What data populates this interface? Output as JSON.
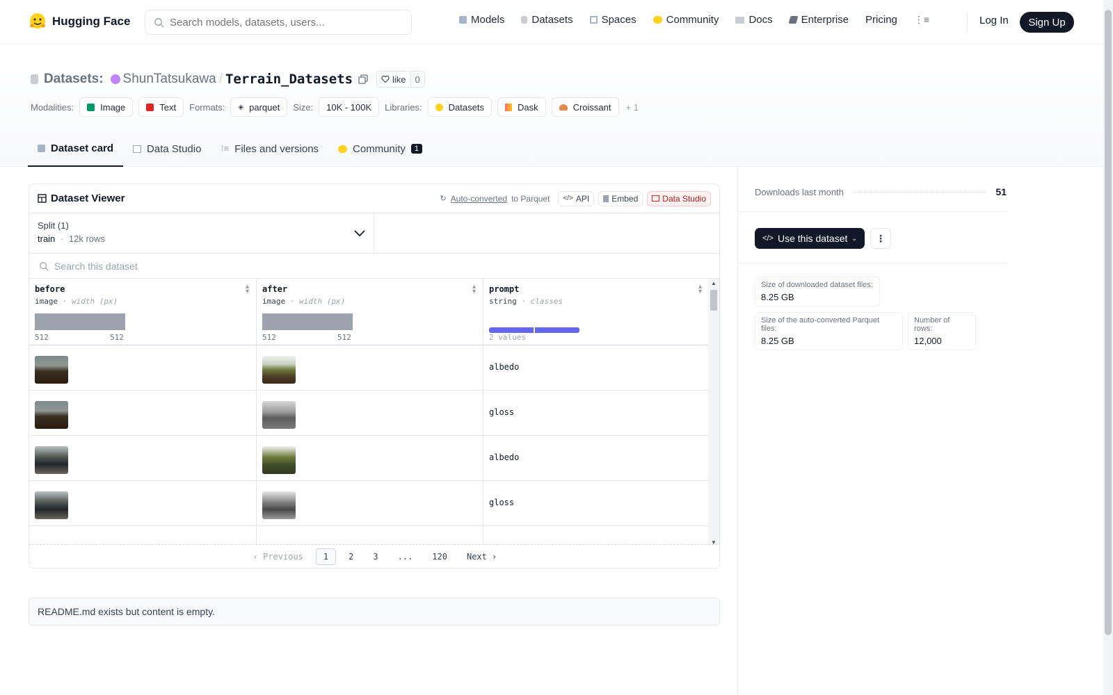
{
  "brand": {
    "name": "Hugging Face"
  },
  "search": {
    "placeholder": "Search models, datasets, users..."
  },
  "nav": {
    "links": [
      "Models",
      "Datasets",
      "Spaces",
      "Community",
      "Docs",
      "Enterprise",
      "Pricing"
    ],
    "login": "Log In",
    "signup": "Sign Up"
  },
  "repo": {
    "prefix": "Datasets:",
    "user": "ShunTatsukawa",
    "slash": "/",
    "name": "Terrain_Datasets",
    "like": "like",
    "likes": "0"
  },
  "tags": {
    "modalities_label": "Modalities:",
    "modalities": [
      "Image",
      "Text"
    ],
    "formats_label": "Formats:",
    "formats": [
      "parquet"
    ],
    "size_label": "Size:",
    "size": "10K - 100K",
    "libraries_label": "Libraries:",
    "libraries": [
      "Datasets",
      "Dask",
      "Croissant"
    ],
    "more": "+ 1"
  },
  "tabs": [
    {
      "label": "Dataset card"
    },
    {
      "label": "Data Studio"
    },
    {
      "label": "Files and versions"
    },
    {
      "label": "Community",
      "badge": "1"
    }
  ],
  "viewer": {
    "title": "Dataset Viewer",
    "auto": "Auto-converted",
    "auto_to": "to Parquet",
    "api": "API",
    "embed": "Embed",
    "studio": "Data Studio",
    "split_label": "Split (1)",
    "split_value": "train",
    "split_sep": "·",
    "split_rows": "12k rows",
    "search_placeholder": "Search this dataset",
    "columns": [
      {
        "name": "before",
        "type": "image",
        "sub": "· width (px)",
        "min": "512",
        "max": "512"
      },
      {
        "name": "after",
        "type": "image",
        "sub": "· width (px)",
        "min": "512",
        "max": "512"
      },
      {
        "name": "prompt",
        "type": "string",
        "sub": "· classes",
        "values": "2 values"
      }
    ],
    "rows": [
      {
        "prompt": "albedo"
      },
      {
        "prompt": "gloss"
      },
      {
        "prompt": "albedo"
      },
      {
        "prompt": "gloss"
      },
      {
        "prompt": ""
      }
    ],
    "pager": {
      "prev": "Previous",
      "pages": [
        "1",
        "2",
        "3",
        "...",
        "120"
      ],
      "next": "Next"
    }
  },
  "readme": "README.md exists but content is empty.",
  "side": {
    "downloads_label": "Downloads last month",
    "downloads": "51",
    "use": "Use this dataset",
    "stats": [
      {
        "k": "Size of downloaded dataset files:",
        "v": "8.25 GB"
      },
      {
        "k": "Size of the auto-converted Parquet files:",
        "v": "8.25 GB"
      },
      {
        "k": "Number of rows:",
        "v": "12,000"
      }
    ]
  },
  "colors": {
    "accent": "#111827",
    "bar": "#6366f1",
    "hist": "#9ca3af"
  }
}
